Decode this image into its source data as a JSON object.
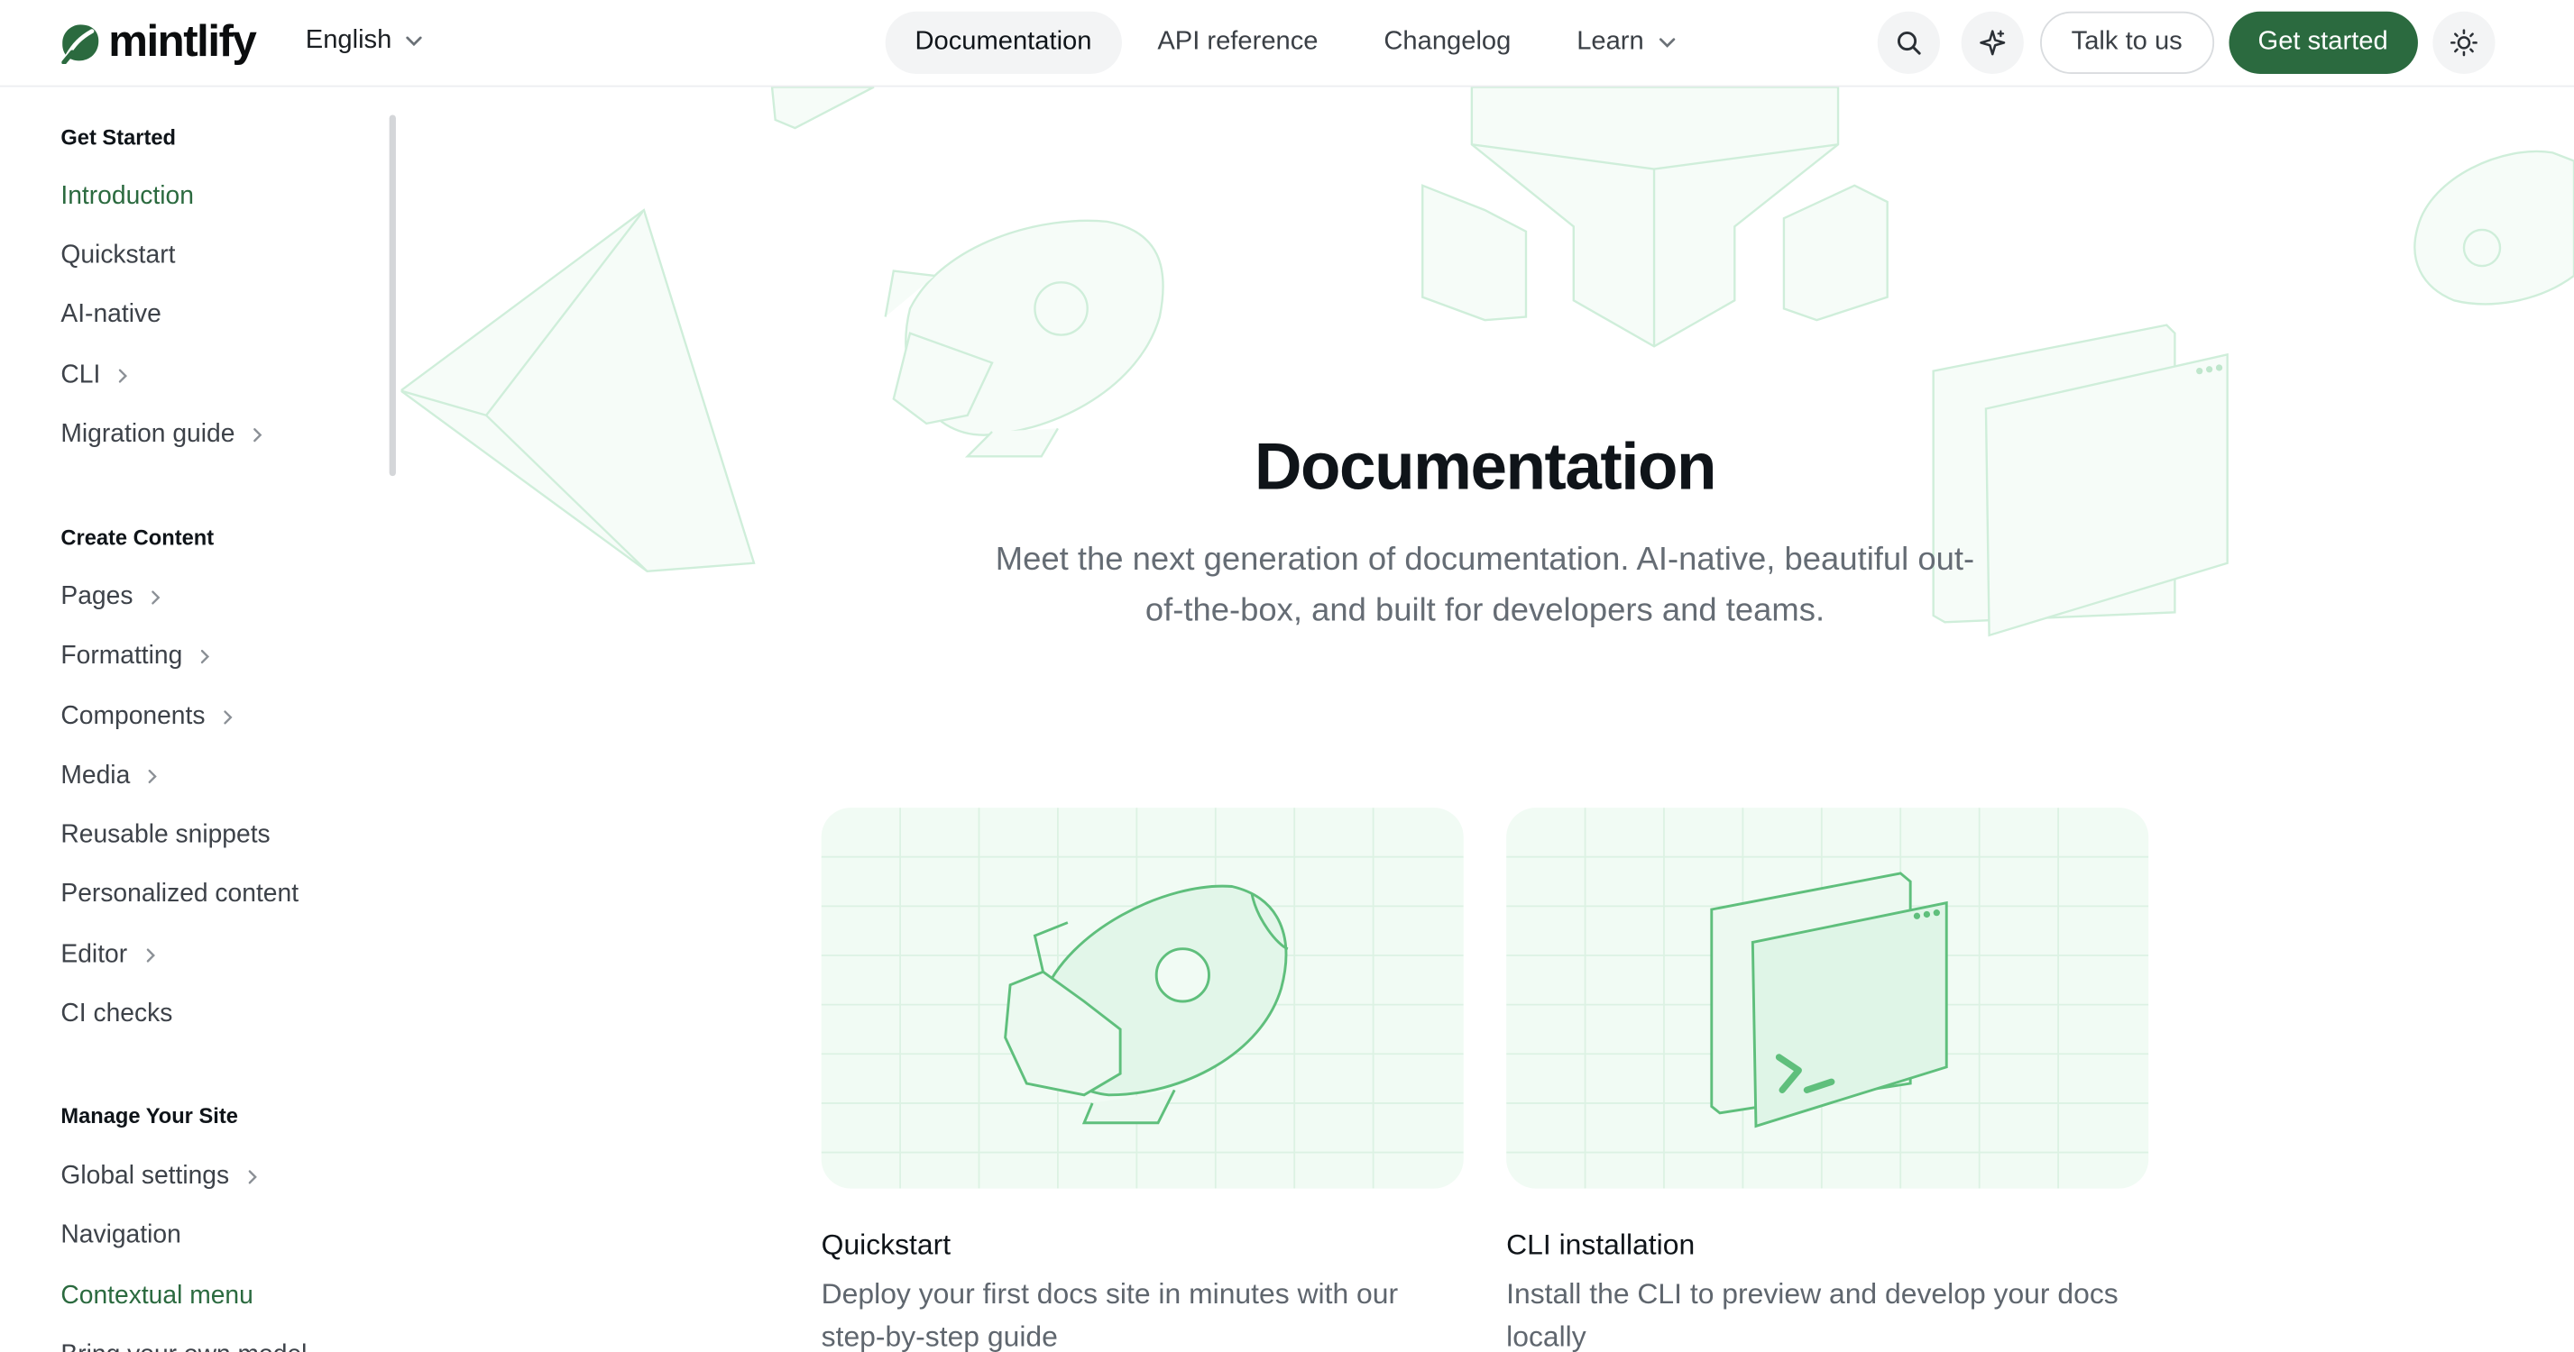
{
  "brand": {
    "name": "mintlify",
    "accent": "#2b6a3f",
    "accent_light": "#f1fbf4"
  },
  "header": {
    "language": "English",
    "nav": [
      {
        "label": "Documentation",
        "active": true
      },
      {
        "label": "API reference"
      },
      {
        "label": "Changelog"
      },
      {
        "label": "Learn"
      }
    ],
    "talk_label": "Talk to us",
    "get_started_label": "Get started"
  },
  "sidebar": {
    "groups": [
      {
        "title": "Get Started",
        "items": [
          {
            "label": "Introduction",
            "active": true
          },
          {
            "label": "Quickstart"
          },
          {
            "label": "AI-native"
          },
          {
            "label": "CLI",
            "chevron": true
          },
          {
            "label": "Migration guide",
            "chevron": true
          }
        ]
      },
      {
        "title": "Create Content",
        "items": [
          {
            "label": "Pages",
            "chevron": true
          },
          {
            "label": "Formatting",
            "chevron": true
          },
          {
            "label": "Components",
            "chevron": true
          },
          {
            "label": "Media",
            "chevron": true
          },
          {
            "label": "Reusable snippets"
          },
          {
            "label": "Personalized content"
          },
          {
            "label": "Editor",
            "chevron": true
          },
          {
            "label": "CI checks"
          }
        ]
      },
      {
        "title": "Manage Your Site",
        "items": [
          {
            "label": "Global settings",
            "chevron": true
          },
          {
            "label": "Navigation"
          },
          {
            "label": "Contextual menu",
            "active": true
          },
          {
            "label": "Bring your own model"
          }
        ]
      }
    ]
  },
  "hero": {
    "title": "Documentation",
    "subtitle": "Meet the next generation of documentation. AI-native, beautiful out-of-the-box, and built for developers and teams."
  },
  "cards": [
    {
      "title": "Quickstart",
      "description": "Deploy your first docs site in minutes with our step-by-step guide",
      "icon": "rocket-illustration"
    },
    {
      "title": "CLI installation",
      "description": "Install the CLI to preview and develop your docs locally",
      "icon": "terminal-window-illustration"
    }
  ]
}
